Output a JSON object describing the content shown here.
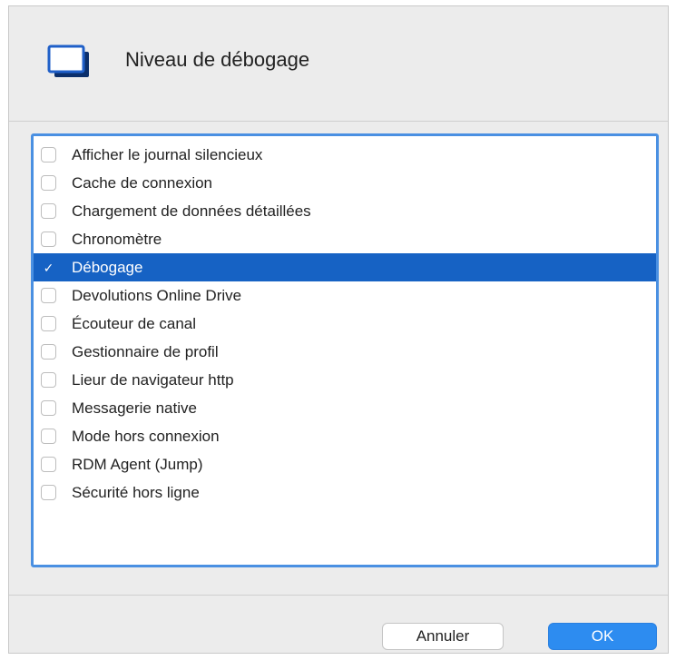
{
  "dialog": {
    "title": "Niveau de débogage",
    "icon": "window-icon",
    "accent_color": "#1662c4",
    "focus_color": "#4a90e2"
  },
  "items": [
    {
      "label": "Afficher le journal silencieux",
      "checked": false,
      "selected": false
    },
    {
      "label": "Cache de connexion",
      "checked": false,
      "selected": false
    },
    {
      "label": "Chargement de données détaillées",
      "checked": false,
      "selected": false
    },
    {
      "label": "Chronomètre",
      "checked": false,
      "selected": false
    },
    {
      "label": "Débogage",
      "checked": true,
      "selected": true
    },
    {
      "label": "Devolutions Online Drive",
      "checked": false,
      "selected": false
    },
    {
      "label": "Écouteur de canal",
      "checked": false,
      "selected": false
    },
    {
      "label": "Gestionnaire de profil",
      "checked": false,
      "selected": false
    },
    {
      "label": "Lieur de navigateur http",
      "checked": false,
      "selected": false
    },
    {
      "label": "Messagerie native",
      "checked": false,
      "selected": false
    },
    {
      "label": "Mode hors connexion",
      "checked": false,
      "selected": false
    },
    {
      "label": "RDM Agent (Jump)",
      "checked": false,
      "selected": false
    },
    {
      "label": "Sécurité hors ligne",
      "checked": false,
      "selected": false
    }
  ],
  "buttons": {
    "cancel_label": "Annuler",
    "ok_label": "OK",
    "ok_color": "#2d8cf0"
  }
}
